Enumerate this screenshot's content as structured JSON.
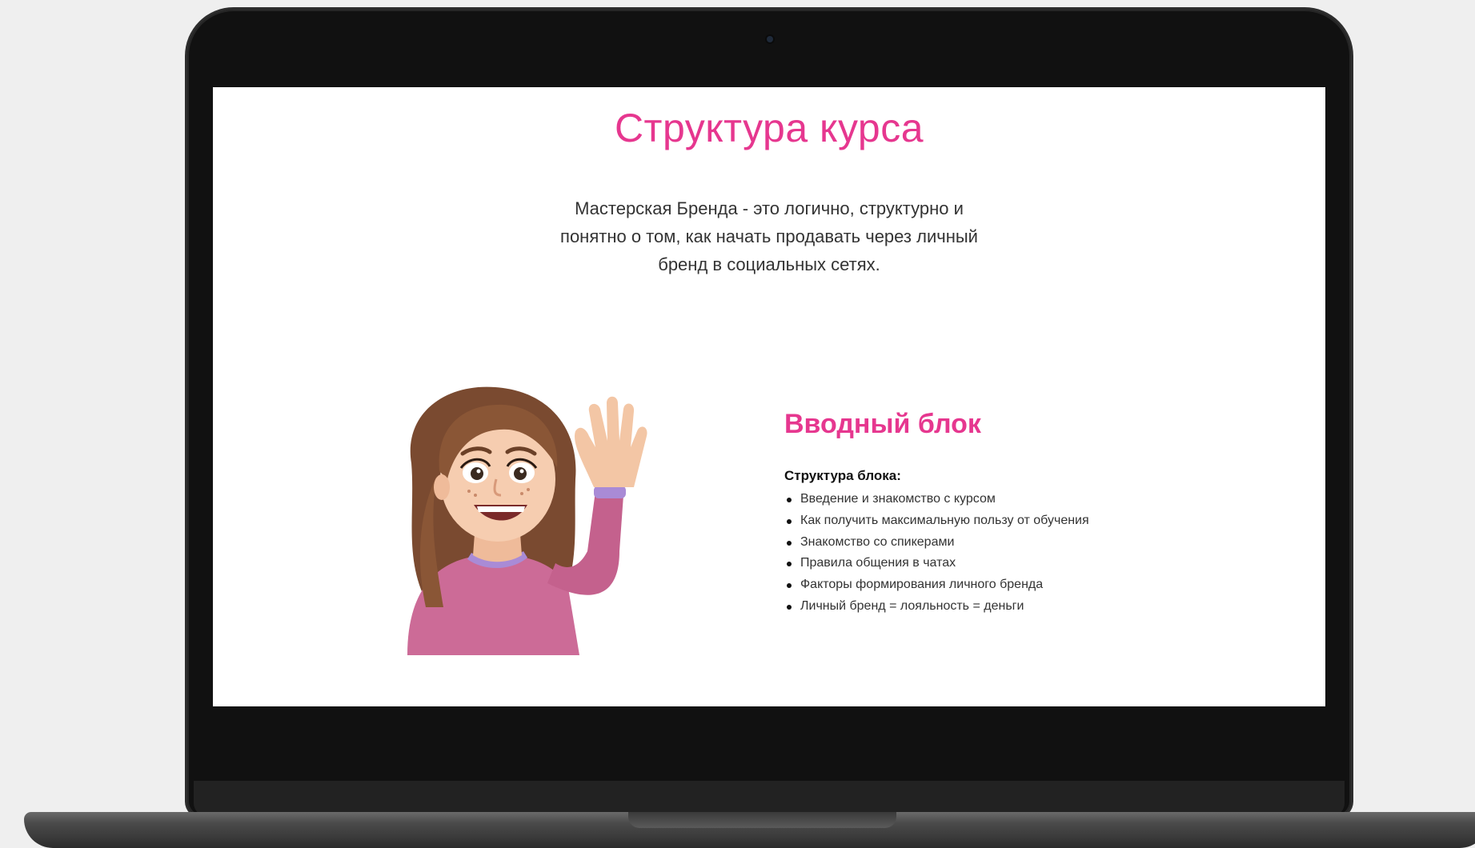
{
  "page": {
    "title": "Структура курса",
    "intro": "Мастерская Бренда - это логично, структурно и понятно о том, как начать продавать через личный бренд в социальных сетях."
  },
  "block": {
    "title": "Вводный блок",
    "subtitle": "Структура блока:",
    "items": [
      "Введение и знакомство с курсом",
      "Как получить максимальную пользу от обучения",
      "Знакомство со спикерами",
      "Правила общения в чатах",
      "Факторы формирования личного бренда",
      "Личный бренд = лояльность = деньги"
    ]
  },
  "colors": {
    "accent": "#e6378f",
    "text": "#333333",
    "laptop_frame": "#111111"
  },
  "icons": {
    "avatar": "waving-girl-memoji"
  }
}
